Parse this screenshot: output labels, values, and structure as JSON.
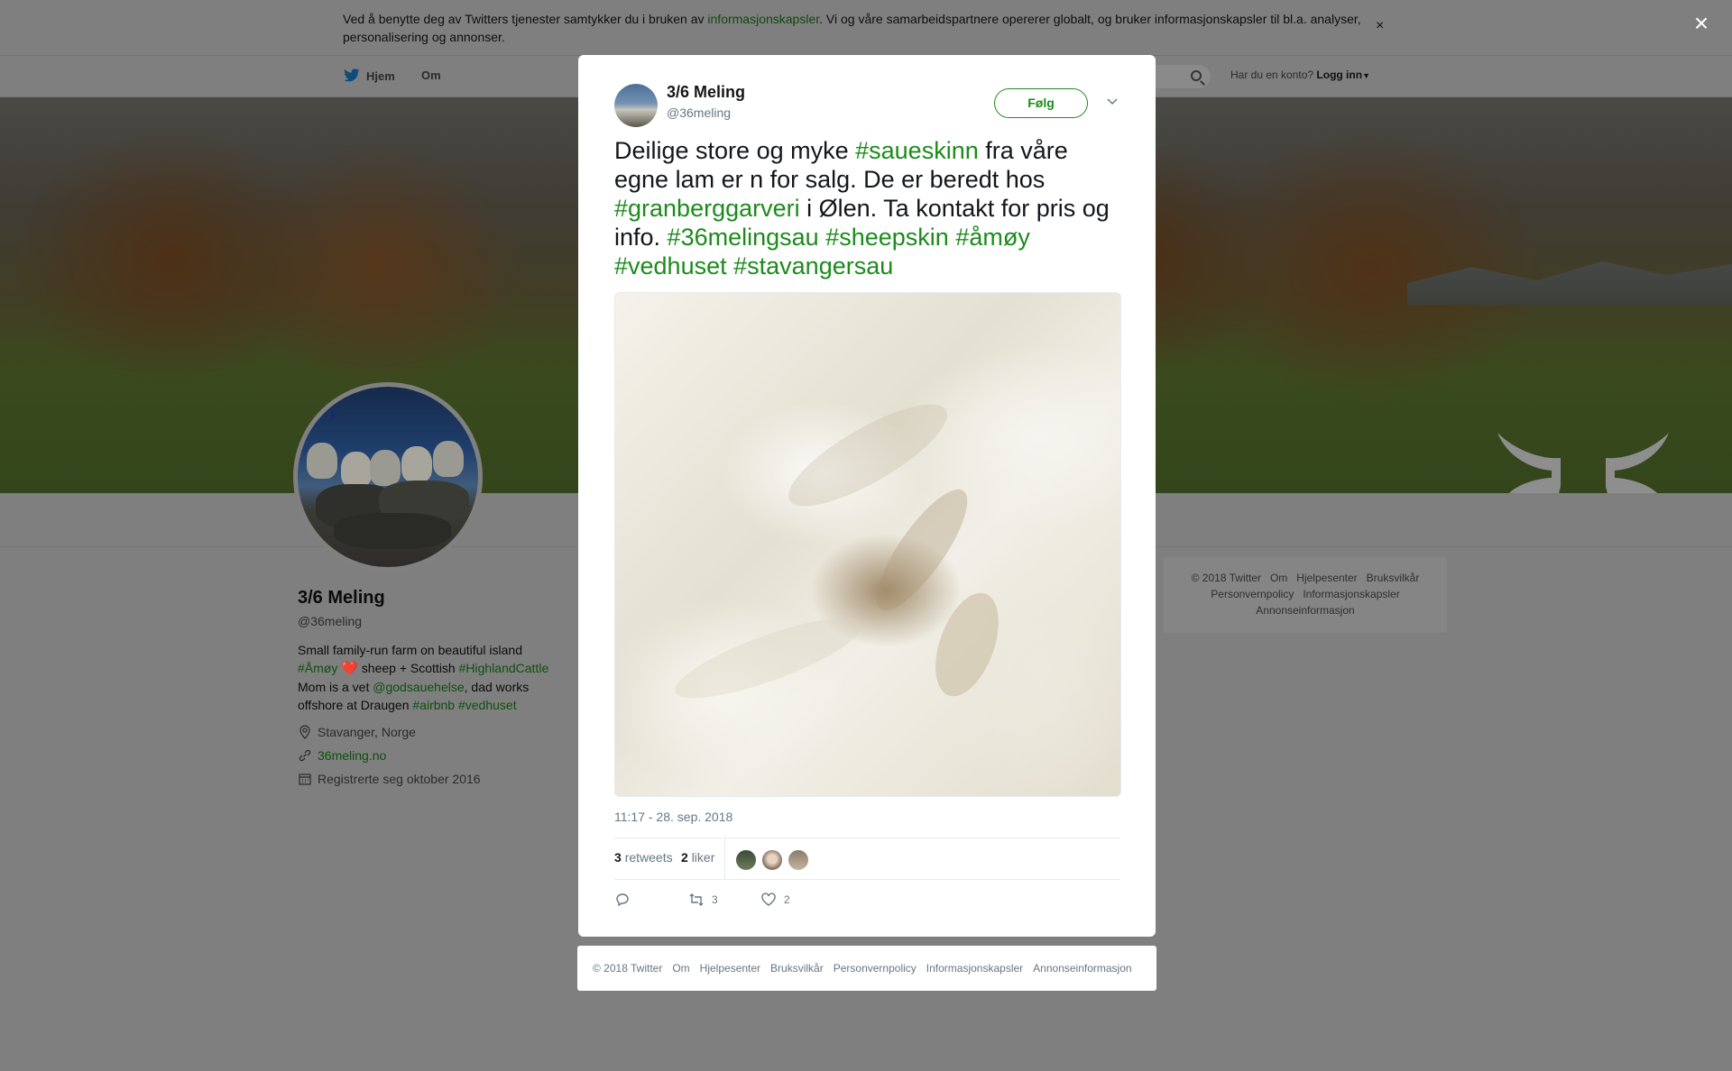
{
  "cookie_banner": {
    "text_before": "Ved å benytte deg av Twitters tjenester samtykker du i bruken av ",
    "link": "informasjonskapsler",
    "text_after": ". Vi og våre samarbeidspartnere opererer globalt, og bruker informasjonskapsler til bl.a. analyser, personalisering og annonser.",
    "close": "×"
  },
  "nav": {
    "home": "Hjem",
    "about": "Om",
    "login_prompt": "Har du en konto?",
    "login": "Logg inn"
  },
  "profile": {
    "name": "3/6 Meling",
    "handle": "@36meling",
    "bio_1": "Small family-run farm on beautiful island",
    "bio_tag_amoy": "#Åmøy",
    "bio_heart": "❤️",
    "bio_2": " sheep + Scottish ",
    "bio_tag_highland": "#HighlandCattle",
    "bio_3": "Mom is a vet ",
    "bio_mention": "@godsauehelse",
    "bio_4": ", dad works offshore at Draugen ",
    "bio_tag_airbnb": "#airbnb",
    "bio_tag_vedhuset": "#vedhuset",
    "location": "Stavanger, Norge",
    "website": "36meling.no",
    "joined": "Registrerte seg oktober 2016"
  },
  "side_footer": {
    "copyright": "© 2018 Twitter",
    "om": "Om",
    "help": "Hjelpesenter",
    "terms": "Bruksvilkår",
    "privacy": "Personvernpolicy",
    "cookies": "Informasjonskapsler",
    "ads": "Annonseinformasjon"
  },
  "overlay_close": "×",
  "tweet": {
    "author_name": "3/6 Meling",
    "author_handle": "@36meling",
    "follow_label": "Følg",
    "text": {
      "t1": "Deilige store og myke ",
      "h1": "#saueskinn",
      "t2": " fra våre egne lam er n for salg. De er beredt hos ",
      "h2": "#granberggarveri",
      "t3": " i Ølen. Ta kontakt for pris og info. ",
      "h3": "#36melingsau",
      "h4": "#sheepskin",
      "h5": "#åmøy",
      "h6": "#vedhuset",
      "h7": "#stavangersau"
    },
    "timestamp": "11:17 - 28. sep. 2018",
    "retweets_count": "3",
    "retweets_label": "retweets",
    "likes_count": "2",
    "likes_label": "liker",
    "action_retweet_count": "3",
    "action_like_count": "2"
  },
  "modal_footer": {
    "copyright": "© 2018 Twitter",
    "om": "Om",
    "help": "Hjelpesenter",
    "terms": "Bruksvilkår",
    "privacy": "Personvernpolicy",
    "cookies": "Informasjonskapsler",
    "ads": "Annonseinformasjon"
  },
  "colors": {
    "accent": "#1c8b1c",
    "overlay": "#7f7f7f",
    "muted": "#657786"
  }
}
